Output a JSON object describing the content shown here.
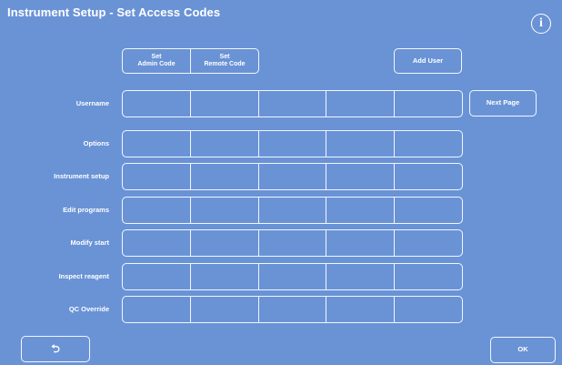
{
  "window": {
    "title": "Instrument Setup - Set Access Codes",
    "info_icon": "info-icon"
  },
  "toolbar": {
    "set_admin_code": "Set\nAdmin Code",
    "set_remote_code": "Set\nRemote Code",
    "add_user": "Add User",
    "next_page": "Next Page"
  },
  "rows": [
    {
      "label": "Username",
      "cells": [
        "",
        "",
        "",
        "",
        ""
      ]
    },
    {
      "label": "Options",
      "cells": [
        "",
        "",
        "",
        "",
        ""
      ]
    },
    {
      "label": "Instrument setup",
      "cells": [
        "",
        "",
        "",
        "",
        ""
      ]
    },
    {
      "label": "Edit programs",
      "cells": [
        "",
        "",
        "",
        "",
        ""
      ]
    },
    {
      "label": "Modify start",
      "cells": [
        "",
        "",
        "",
        "",
        ""
      ]
    },
    {
      "label": "Inspect reagent",
      "cells": [
        "",
        "",
        "",
        "",
        ""
      ]
    },
    {
      "label": "QC Override",
      "cells": [
        "",
        "",
        "",
        "",
        ""
      ]
    }
  ],
  "footer": {
    "back_icon": "back-arrow-icon",
    "back_glyph": "⮌",
    "ok": "OK"
  },
  "colors": {
    "background": "#6a93d6",
    "outline": "#f2f6ff",
    "text": "#ffffff"
  }
}
